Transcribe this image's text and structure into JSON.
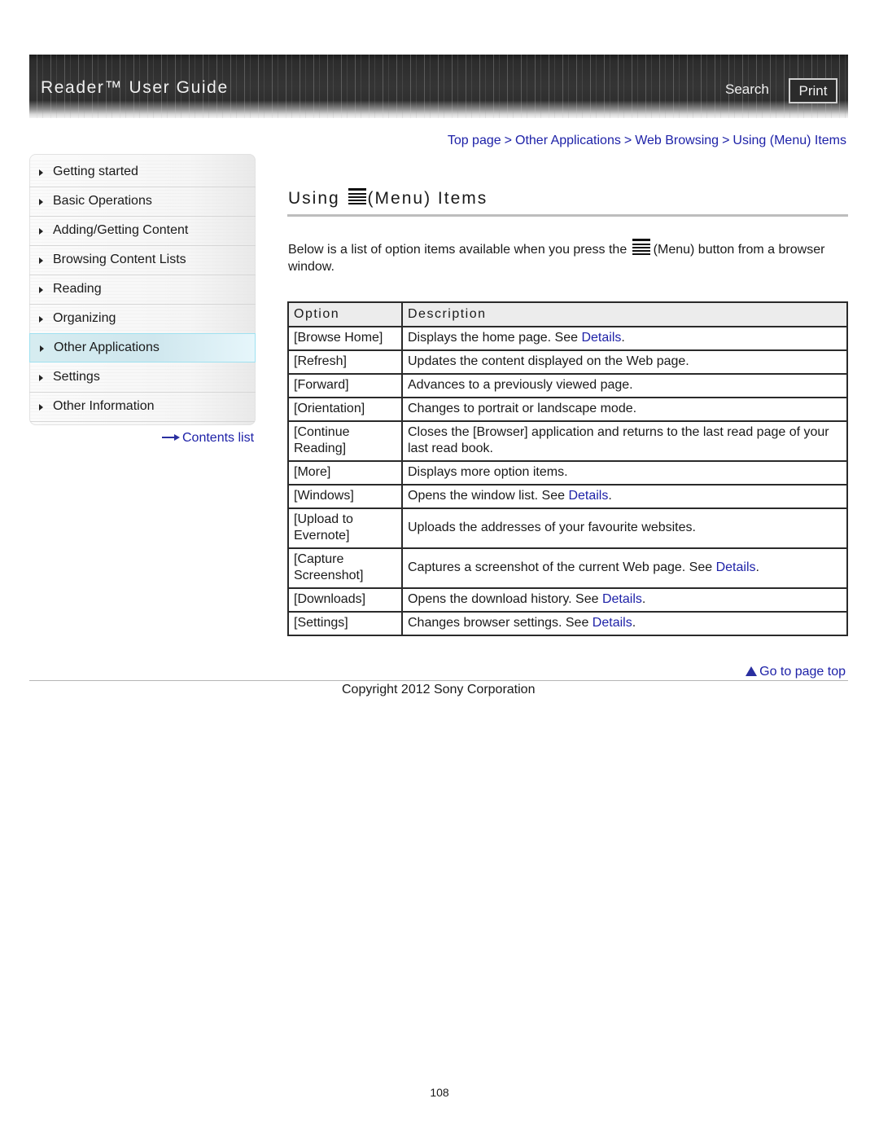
{
  "header": {
    "title": "Reader™ User Guide",
    "search_label": "Search",
    "print_label": "Print"
  },
  "sidebar": {
    "items": [
      {
        "label": "Getting started",
        "active": false
      },
      {
        "label": "Basic Operations",
        "active": false
      },
      {
        "label": "Adding/Getting Content",
        "active": false
      },
      {
        "label": "Browsing Content Lists",
        "active": false
      },
      {
        "label": "Reading",
        "active": false
      },
      {
        "label": "Organizing",
        "active": false
      },
      {
        "label": "Other Applications",
        "active": true
      },
      {
        "label": "Settings",
        "active": false
      },
      {
        "label": "Other Information",
        "active": false
      }
    ],
    "contents_link": "Contents list"
  },
  "breadcrumb": {
    "items": [
      "Top page",
      "Other Applications",
      "Web Browsing",
      "Using (Menu) Items"
    ],
    "separator": ">"
  },
  "main": {
    "title_before": "Using",
    "title_after": "(Menu) Items",
    "intro_before": "Below is a list of option items available when you press the",
    "intro_after": "(Menu) button from a browser window.",
    "table": {
      "headers": [
        "Option",
        "Description"
      ],
      "rows": [
        {
          "option": "[Browse Home]",
          "description": "Displays the home page. See ",
          "link": "Details",
          "suffix": "."
        },
        {
          "option": "[Refresh]",
          "description": "Updates the content displayed on the Web page.",
          "link": null,
          "suffix": ""
        },
        {
          "option": "[Forward]",
          "description": "Advances to a previously viewed page.",
          "link": null,
          "suffix": ""
        },
        {
          "option": "[Orientation]",
          "description": "Changes to portrait or landscape mode.",
          "link": null,
          "suffix": ""
        },
        {
          "option": "[Continue Reading]",
          "description": "Closes the [Browser] application and returns to the last read page of your last read book.",
          "link": null,
          "suffix": ""
        },
        {
          "option": "[More]",
          "description": "Displays more option items.",
          "link": null,
          "suffix": ""
        },
        {
          "option": "[Windows]",
          "description": "Opens the window list. See ",
          "link": "Details",
          "suffix": "."
        },
        {
          "option": "[Upload to Evernote]",
          "description": "Uploads the addresses of your favourite websites.",
          "link": null,
          "suffix": ""
        },
        {
          "option": "[Capture Screenshot]",
          "description": "Captures a screenshot of the current Web page. See ",
          "link": "Details",
          "suffix": "."
        },
        {
          "option": "[Downloads]",
          "description": "Opens the download history. See ",
          "link": "Details",
          "suffix": "."
        },
        {
          "option": "[Settings]",
          "description": "Changes browser settings. See ",
          "link": "Details",
          "suffix": "."
        }
      ]
    }
  },
  "footer": {
    "go_to_top": "Go to page top",
    "copyright": "Copyright 2012 Sony Corporation",
    "page_number": "108"
  },
  "colors": {
    "link": "#1e22a8",
    "banner": "#2e2e2e",
    "active_nav": "#d6ecf0"
  }
}
